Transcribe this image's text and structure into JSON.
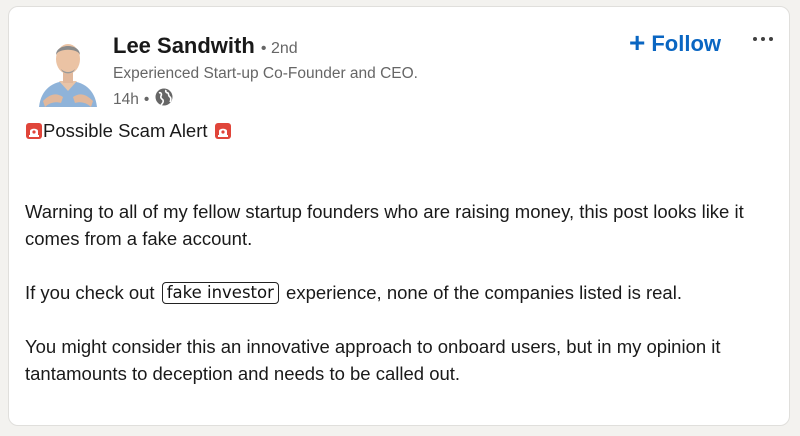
{
  "actor": {
    "name": "Lee Sandwith",
    "degree": "• 2nd",
    "headline": "Experienced Start-up Co-Founder and CEO.",
    "time": "14h",
    "separator": "•",
    "visibility_icon": "globe-icon",
    "avatar_icon": "profile-photo"
  },
  "actions": {
    "follow_plus": "+",
    "follow_label": "Follow",
    "more_icon": "ellipsis-icon"
  },
  "post": {
    "alert_icon": "siren-icon",
    "alert_text": "Possible Scam Alert",
    "paragraph1": "Warning to all of my fellow startup founders who are raising money, this post looks like it comes from a fake account.",
    "paragraph2_before": "If you check out",
    "paragraph2_redacted": "fake investor",
    "paragraph2_after": "experience, none of the companies listed is real.",
    "paragraph3": "You might consider this an innovative approach to onboard users, but in my opinion it tantamounts to deception and needs to be called out."
  },
  "colors": {
    "link_blue": "#0a66c2",
    "muted_text": "#666666",
    "siren_red": "#e0453a"
  }
}
